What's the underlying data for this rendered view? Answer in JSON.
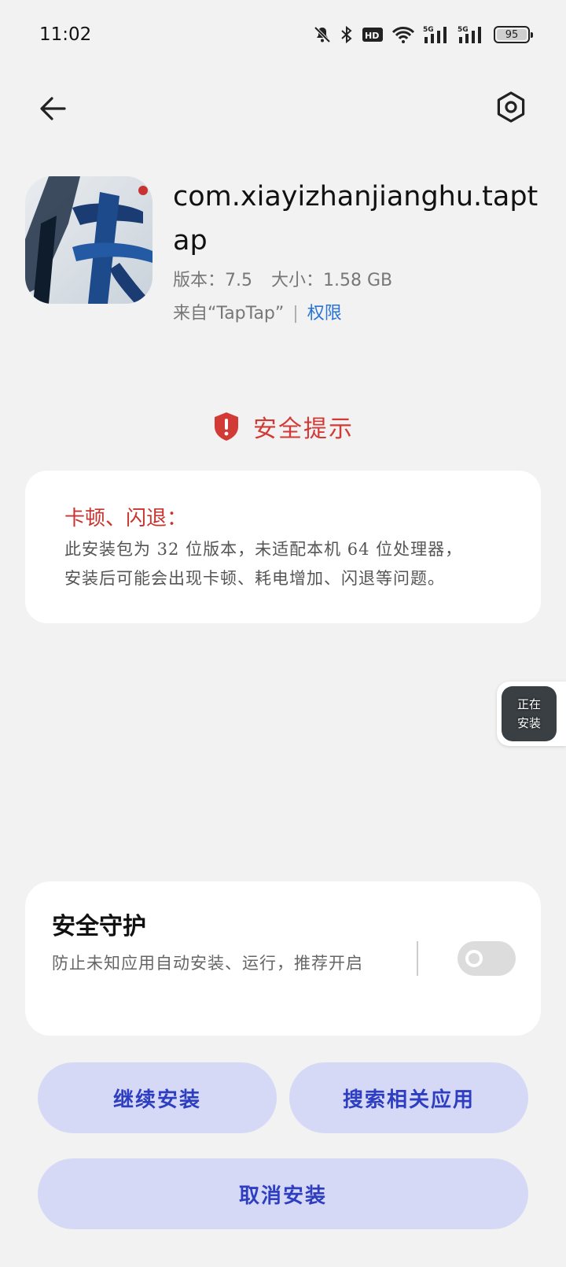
{
  "status_bar": {
    "time": "11:02",
    "icons": [
      "mute-icon",
      "bluetooth-icon",
      "hd-icon",
      "wifi-icon",
      "5g-signal-icon",
      "5g-signal-icon"
    ],
    "battery_level": "95"
  },
  "nav": {
    "back_icon": "arrow-left-icon",
    "settings_icon": "settings-icon"
  },
  "app": {
    "package_name": "com.xiayizhanjianghu.taptap",
    "version_label": "版本：7.5",
    "size_label": "大小：1.58 GB",
    "source_label": "来自“TapTap”",
    "source_divider": "|",
    "permission_link": "权限"
  },
  "security": {
    "title": "安全提示",
    "icon": "shield-alert-icon",
    "accent_color": "#d23a36"
  },
  "warning": {
    "title": "卡顿、闪退：",
    "line1": "此安装包为 32 位版本，未适配本机 64 位处理器，",
    "line2": "安装后可能会出现卡顿、耗电增加、闪退等问题。"
  },
  "floating": {
    "line1": "正在",
    "line2": "安装"
  },
  "protect": {
    "title": "安全守护",
    "description": "防止未知应用自动安装、运行，推荐开启",
    "toggle_on": false
  },
  "buttons": {
    "continue_install": "继续安装",
    "search_related": "搜索相关应用",
    "cancel_install": "取消安装",
    "color": "#2e3ec0",
    "background": "#d6d9f5"
  }
}
